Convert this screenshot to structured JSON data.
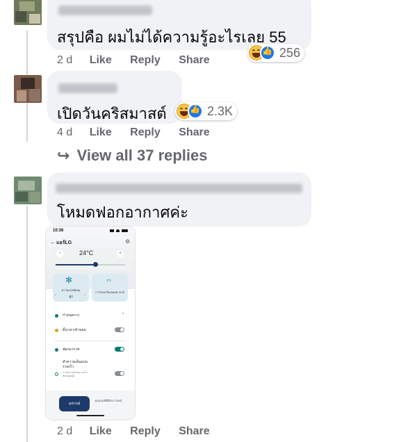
{
  "comments": [
    {
      "text": "สรุปคือ ผมไม่ได้ความรู้อะไรเลย 55",
      "time": "2 d",
      "like_label": "Like",
      "reply_label": "Reply",
      "share_label": "Share",
      "reaction_count": "256"
    },
    {
      "text": "เปิดวันคริสมาสต์",
      "time": "4 d",
      "like_label": "Like",
      "reply_label": "Reply",
      "share_label": "Share",
      "reaction_count": "2.3K"
    },
    {
      "text": "โหมดฟอกอากาศค่ะ",
      "time": "2 d",
      "like_label": "Like",
      "reply_label": "Reply",
      "share_label": "Share"
    }
  ],
  "view_replies": "View all 37 replies",
  "reply_arrow": "↪",
  "screenshot": {
    "status_time": "10:36",
    "title": "แอร์LG",
    "temperature": "24°C",
    "minus": "−",
    "plus": "+",
    "tile1_label": "ความแรงพัดลม",
    "tile1_value": "สูง",
    "tile2_label": "การไหลเวียนของอากาศ",
    "rows": [
      {
        "label": "กำหนดการ"
      },
      {
        "label": "ตั้งเวลาเข้านอน"
      },
      {
        "label": "ฟอกอากาศ"
      },
      {
        "label": "ทำความเย็นแบบรวดเร็ว",
        "sub": "การทำงานด้วยความเร็วพัดลมสูงสุด"
      }
    ],
    "tab_devices": "อุปกรณ์",
    "tab_tips": "คุณสมบัติที่มีประโยชน์"
  },
  "colors": {
    "bubble": "#f0f2f5",
    "secondary_text": "#65676b",
    "like_blue": "#1877f2",
    "haha_yellow": "#f7c44a",
    "app_teal": "#0a7d6e",
    "app_navy": "#1e3a6b"
  }
}
